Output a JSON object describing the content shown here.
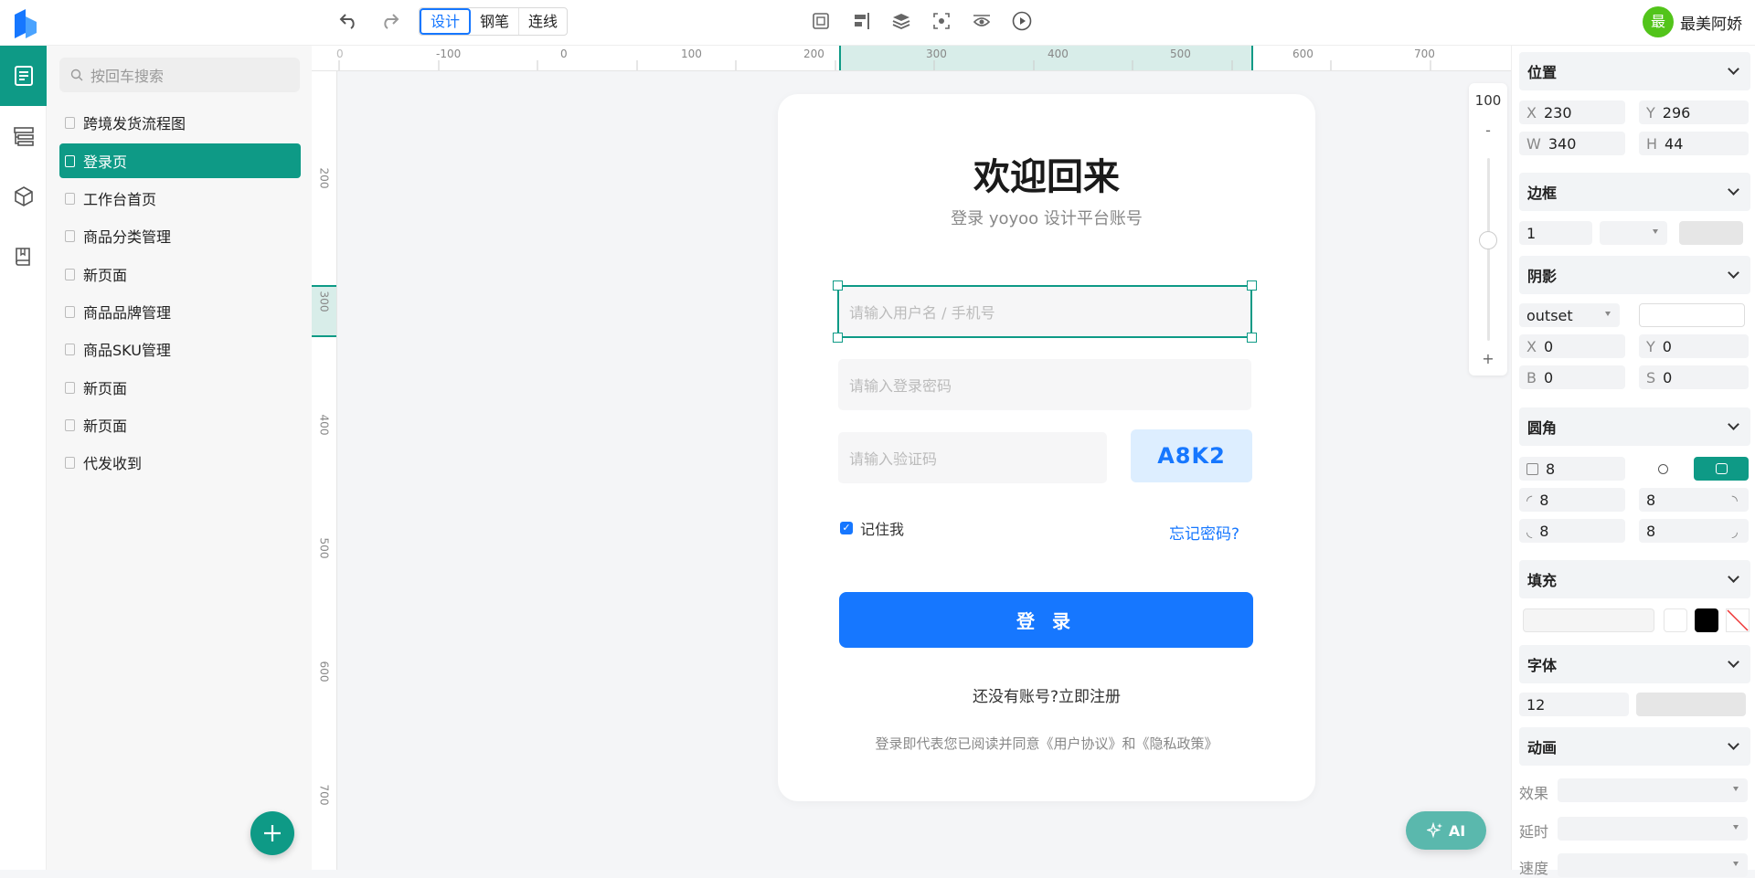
{
  "header": {
    "modes": [
      "设计",
      "钢笔",
      "连线"
    ],
    "active_mode": "设计",
    "user": {
      "avatar_text": "最",
      "name": "最美阿娇"
    }
  },
  "pages_panel": {
    "search_placeholder": "按回车搜索",
    "items": [
      "跨境发货流程图",
      "登录页",
      "工作台首页",
      "商品分类管理",
      "新页面",
      "商品品牌管理",
      "商品SKU管理",
      "新页面",
      "新页面",
      "代发收到"
    ],
    "active_index": 1
  },
  "rulers": {
    "horizontal": [
      "0",
      "-100",
      "0",
      "100",
      "200",
      "300",
      "400",
      "500",
      "600",
      "700"
    ],
    "vertical": [
      "200",
      "300",
      "400",
      "500",
      "600",
      "700"
    ]
  },
  "login_card": {
    "title": "欢迎回来",
    "subtitle": "登录 yoyoo 设计平台账号",
    "username_placeholder": "请输入用户名 / 手机号",
    "password_placeholder": "请输入登录密码",
    "captcha_placeholder": "请输入验证码",
    "captcha_code": "A8K2",
    "remember_label": "记住我",
    "remember_checked": true,
    "forgot_link": "忘记密码?",
    "login_button": "登 录",
    "register_text": "还没有账号?立即注册",
    "agreement_text": "登录即代表您已阅读并同意《用户协议》和《隐私政策》"
  },
  "zoom": {
    "value": "100",
    "minus": "-",
    "plus": "+"
  },
  "ai_button": {
    "label": "AI"
  },
  "properties": {
    "position": {
      "title": "位置",
      "x_label": "X",
      "x": "230",
      "y_label": "Y",
      "y": "296",
      "w_label": "W",
      "w": "340",
      "h_label": "H",
      "h": "44"
    },
    "border": {
      "title": "边框",
      "width": "1"
    },
    "shadow": {
      "title": "阴影",
      "type": "outset",
      "x_label": "X",
      "x": "0",
      "y_label": "Y",
      "y": "0",
      "b_label": "B",
      "b": "0",
      "s_label": "S",
      "s": "0"
    },
    "radius": {
      "title": "圆角",
      "all": "8",
      "tl": "8",
      "tr": "8",
      "bl": "8",
      "br": "8"
    },
    "fill": {
      "title": "填充",
      "swatches": [
        "#ffffff",
        "#000000"
      ]
    },
    "font": {
      "title": "字体",
      "size": "12"
    },
    "animation": {
      "title": "动画",
      "effect_label": "效果",
      "delay_label": "延时",
      "speed_label": "速度"
    }
  },
  "colors": {
    "accent": "#0e9a86",
    "primary": "#1677ff",
    "avatar": "#52c41a"
  }
}
